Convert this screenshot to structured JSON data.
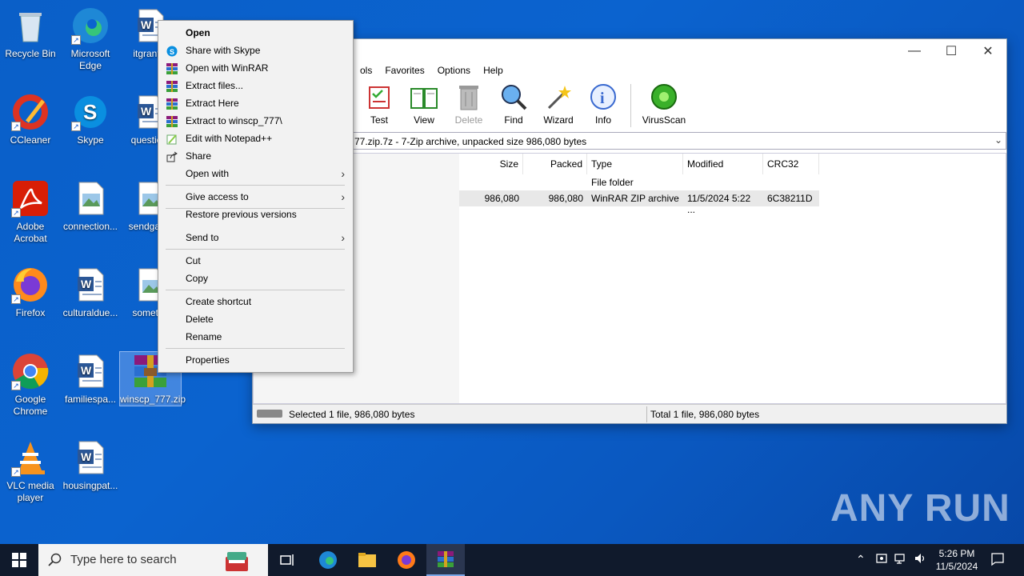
{
  "desktop": {
    "icons": [
      {
        "label": "Recycle Bin",
        "icon": "recycle-bin-icon"
      },
      {
        "label": "Microsoft Edge",
        "icon": "edge-icon"
      },
      {
        "label": "itgrant...",
        "icon": "word-doc-icon"
      },
      {
        "label": "CCleaner",
        "icon": "ccleaner-icon"
      },
      {
        "label": "Skype",
        "icon": "skype-icon"
      },
      {
        "label": "questio...",
        "icon": "word-doc-icon"
      },
      {
        "label": "Adobe Acrobat",
        "icon": "acrobat-icon"
      },
      {
        "label": "connection...",
        "icon": "image-file-icon"
      },
      {
        "label": "sendgall...",
        "icon": "image-file-icon"
      },
      {
        "label": "Firefox",
        "icon": "firefox-icon"
      },
      {
        "label": "culturaldue...",
        "icon": "word-doc-icon"
      },
      {
        "label": "someti...",
        "icon": "image-file-icon"
      },
      {
        "label": "Google Chrome",
        "icon": "chrome-icon"
      },
      {
        "label": "familiespa...",
        "icon": "word-doc-icon"
      },
      {
        "label": "winscp_777.zip",
        "icon": "winrar-archive-icon"
      },
      {
        "label": "VLC media player",
        "icon": "vlc-icon"
      },
      {
        "label": "housingpat...",
        "icon": "word-doc-icon"
      }
    ]
  },
  "winrar": {
    "menu": [
      "ols",
      "Favorites",
      "Options",
      "Help"
    ],
    "toolbar": [
      {
        "label": "Test",
        "icon": "test-icon",
        "disabled": false
      },
      {
        "label": "View",
        "icon": "view-book-icon",
        "disabled": false
      },
      {
        "label": "Delete",
        "icon": "trash-icon",
        "disabled": true
      },
      {
        "label": "Find",
        "icon": "magnifier-icon",
        "disabled": false
      },
      {
        "label": "Wizard",
        "icon": "wizard-wand-icon",
        "disabled": false
      },
      {
        "label": "Info",
        "icon": "info-icon",
        "disabled": false
      },
      {
        "label": "VirusScan",
        "icon": "virus-scan-icon",
        "disabled": false
      }
    ],
    "path": "77.zip.7z - 7-Zip archive, unpacked size 986,080 bytes",
    "columns": [
      "Size",
      "Packed",
      "Type",
      "Modified",
      "CRC32"
    ],
    "rows": [
      {
        "size": "",
        "packed": "",
        "type": "File folder",
        "modified": "",
        "crc": ""
      },
      {
        "size": "986,080",
        "packed": "986,080",
        "type": "WinRAR ZIP archive",
        "modified": "11/5/2024 5:22 ...",
        "crc": "6C38211D"
      }
    ],
    "status_left": "Selected 1 file, 986,080 bytes",
    "status_right": "Total 1 file, 986,080 bytes"
  },
  "context_menu": {
    "items": [
      {
        "label": "Open",
        "icon": "",
        "bold": true,
        "submenu": false
      },
      {
        "label": "Share with Skype",
        "icon": "skype-icon",
        "bold": false,
        "submenu": false
      },
      {
        "label": "Open with WinRAR",
        "icon": "winrar-icon",
        "bold": false,
        "submenu": false
      },
      {
        "label": "Extract files...",
        "icon": "winrar-icon",
        "bold": false,
        "submenu": false
      },
      {
        "label": "Extract Here",
        "icon": "winrar-icon",
        "bold": false,
        "submenu": false
      },
      {
        "label": "Extract to winscp_777\\",
        "icon": "winrar-icon",
        "bold": false,
        "submenu": false
      },
      {
        "label": "Edit with Notepad++",
        "icon": "notepadpp-icon",
        "bold": false,
        "submenu": false
      },
      {
        "label": "Share",
        "icon": "share-icon",
        "bold": false,
        "submenu": false
      },
      {
        "label": "Open with",
        "icon": "",
        "bold": false,
        "submenu": true
      },
      {
        "label": "Give access to",
        "icon": "",
        "bold": false,
        "submenu": true
      },
      {
        "label": "Restore previous versions",
        "icon": "",
        "bold": false,
        "submenu": false
      },
      {
        "label": "Send to",
        "icon": "",
        "bold": false,
        "submenu": true
      },
      {
        "label": "Cut",
        "icon": "",
        "bold": false,
        "submenu": false
      },
      {
        "label": "Copy",
        "icon": "",
        "bold": false,
        "submenu": false
      },
      {
        "label": "Create shortcut",
        "icon": "",
        "bold": false,
        "submenu": false
      },
      {
        "label": "Delete",
        "icon": "",
        "bold": false,
        "submenu": false
      },
      {
        "label": "Rename",
        "icon": "",
        "bold": false,
        "submenu": false
      },
      {
        "label": "Properties",
        "icon": "",
        "bold": false,
        "submenu": false
      }
    ]
  },
  "taskbar": {
    "search_placeholder": "Type here to search",
    "time": "5:26 PM",
    "date": "11/5/2024"
  },
  "watermark": "ANY RUN"
}
